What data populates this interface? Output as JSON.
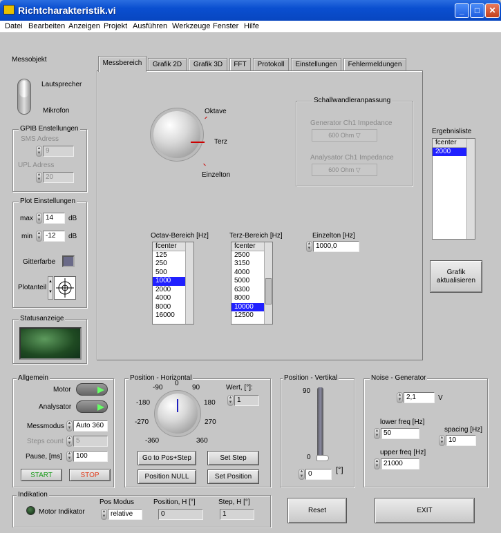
{
  "window": {
    "title": "Richtcharakteristik.vi",
    "min": "_",
    "max": "□",
    "close": "✕"
  },
  "menu": [
    "Datei",
    "Bearbeiten",
    "Anzeigen",
    "Projekt",
    "Ausführen",
    "Werkzeuge",
    "Fenster",
    "Hilfe"
  ],
  "messobjekt": {
    "label": "Messobjekt",
    "on": "Lautsprecher",
    "off": "Mikrofon"
  },
  "gpib": {
    "title": "GPIB Enstellungen",
    "sms_label": "SMS Adress",
    "sms": "9",
    "upl_label": "UPL Adress",
    "upl": "20"
  },
  "plot": {
    "title": "Plot  Einstellungen",
    "max_label": "max",
    "max": "14",
    "min_label": "min",
    "min": "-12",
    "unit": "dB",
    "grid_label": "Gitterfarbe",
    "plotanteil_label": "Plotanteil"
  },
  "status": {
    "title": "Statusanzeige"
  },
  "tabs": [
    "Messbereich",
    "Grafik 2D",
    "Grafik 3D",
    "FFT",
    "Protokoll",
    "Einstellungen",
    "Fehlermeldungen"
  ],
  "messbereich": {
    "knob_labels": [
      "Oktave",
      "Terz",
      "Einzelton"
    ],
    "schall": {
      "title": "Schallwandleranpassung",
      "gen_label": "Generator Ch1 Impedance",
      "gen": "600 Ohm",
      "ana_label": "Analysator Ch1 Impedance",
      "ana": "600 Ohm"
    },
    "octav": {
      "label": "Octav-Bereich [Hz]",
      "header": "fcenter",
      "items": [
        "125",
        "250",
        "500",
        "1000",
        "2000",
        "4000",
        "8000",
        "16000"
      ],
      "selected": "1000"
    },
    "terz": {
      "label": "Terz-Bereich [Hz]",
      "header": "fcenter",
      "items": [
        "2500",
        "3150",
        "4000",
        "5000",
        "6300",
        "8000",
        "10000",
        "12500"
      ],
      "selected": "10000"
    },
    "einzelton": {
      "label": "Einzelton [Hz]",
      "value": "1000,0"
    }
  },
  "ergebnis": {
    "label": "Ergebnisliste",
    "header": "fcenter",
    "items": [
      "2000"
    ]
  },
  "grafik_button": "Grafik aktualisieren",
  "allgemein": {
    "title": "Allgemein",
    "motor": "Motor",
    "analysator": "Analysator",
    "messmodus_label": "Messmodus",
    "messmodus": "Auto 360",
    "steps_label": "Steps count",
    "steps": "5",
    "pause_label": "Pause, [ms]",
    "pause": "100",
    "start": "START",
    "stop": "STOP"
  },
  "horiz": {
    "title": "Position - Horizontal",
    "ticks": [
      "-90",
      "0",
      "90",
      "-180",
      "180",
      "-270",
      "270",
      "-360",
      "360"
    ],
    "wert_label": "Wert, [°]:",
    "wert": "1",
    "btn_goto": "Go to Pos+Step",
    "btn_setstep": "Set Step",
    "btn_null": "Position NULL",
    "btn_setpos": "Set Position"
  },
  "vert": {
    "title": "Position - Vertikal",
    "tick_top": "90",
    "tick_bottom": "0",
    "value": "0",
    "unit": "[°]",
    "slider_value": 0
  },
  "noise": {
    "title": "Noise - Generator",
    "amp": "2,1",
    "amp_unit": "V",
    "lower_label": "lower freq [Hz]",
    "lower": "50",
    "spacing_label": "spacing [Hz]",
    "spacing": "10",
    "upper_label": "upper freq [Hz]",
    "upper": "21000"
  },
  "indikation": {
    "title": "Indikation",
    "motor_ind": "Motor Indikator",
    "posmodus_label": "Pos Modus",
    "posmodus": "relative",
    "posh_label": "Position, H [°]",
    "posh": "0",
    "steph_label": "Step, H [°]",
    "steph": "1"
  },
  "reset": "Reset",
  "exit": "EXIT"
}
